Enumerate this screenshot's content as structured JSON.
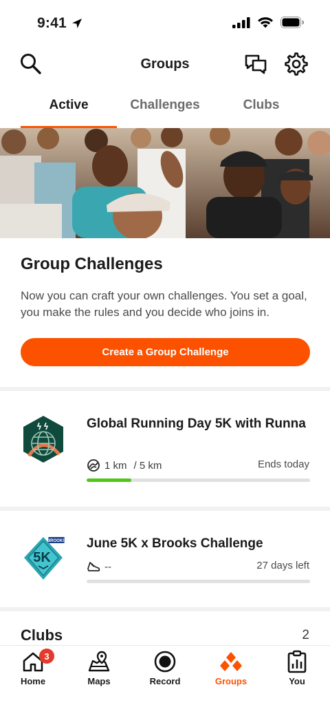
{
  "status_bar": {
    "time": "9:41"
  },
  "header": {
    "title": "Groups"
  },
  "tabs": [
    {
      "label": "Active",
      "active": true
    },
    {
      "label": "Challenges",
      "active": false
    },
    {
      "label": "Clubs",
      "active": false
    }
  ],
  "promo": {
    "title": "Group Challenges",
    "description": "Now you can craft your own challenges. You set a goal, you make the rules and you decide who joins in.",
    "button_label": "Create a Group Challenge"
  },
  "challenges": [
    {
      "title": "Global Running Day 5K with Runna",
      "progress_value": "1 km",
      "goal": "/ 5 km",
      "remaining": "Ends today",
      "progress_fraction": 0.2,
      "badge_icon": "globe-runna-badge-icon"
    },
    {
      "title": "June 5K x Brooks Challenge",
      "progress_value": "--",
      "goal": "",
      "remaining": "27 days left",
      "progress_fraction": 0,
      "badge_icon": "brooks-5k-badge-icon",
      "badge_text": "5K",
      "badge_brand": "BROOKS"
    }
  ],
  "clubs": {
    "title": "Clubs",
    "count": "2"
  },
  "bottom_nav": [
    {
      "label": "Home",
      "icon": "home-icon",
      "badge": "3",
      "active": false
    },
    {
      "label": "Maps",
      "icon": "maps-icon",
      "active": false
    },
    {
      "label": "Record",
      "icon": "record-icon",
      "active": false
    },
    {
      "label": "Groups",
      "icon": "groups-icon",
      "active": true
    },
    {
      "label": "You",
      "icon": "you-icon",
      "active": false
    }
  ],
  "colors": {
    "brand": "#fc5200",
    "progress": "#52c41a",
    "badge": "#e5392c"
  }
}
